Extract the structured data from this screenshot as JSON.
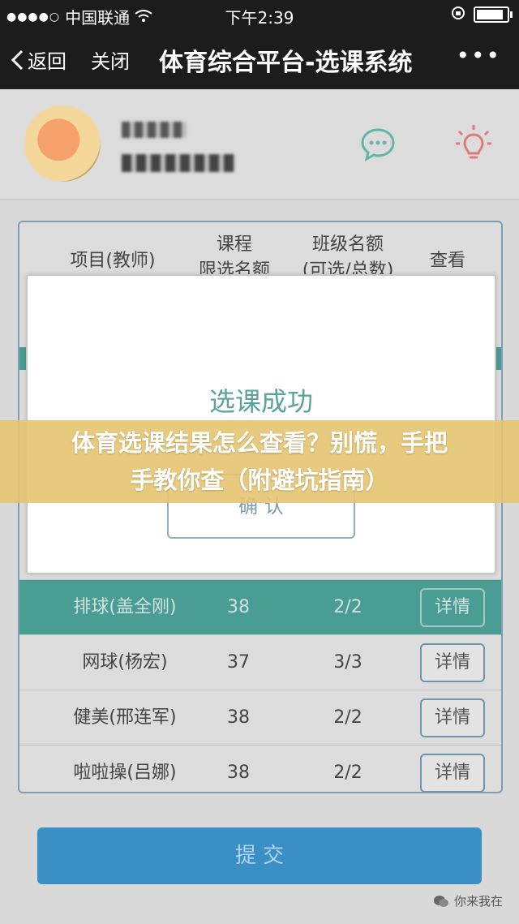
{
  "status_bar": {
    "carrier": "中国联通",
    "time": "下午2:39",
    "battery_level": 0.8
  },
  "navbar": {
    "back_label": "返回",
    "close_label": "关闭",
    "title": "体育综合平台-选课系统",
    "more_label": "•••"
  },
  "table": {
    "headers": [
      {
        "line1": "项目(教师)",
        "line2": ""
      },
      {
        "line1": "课程",
        "line2": "限选名额"
      },
      {
        "line1": "班级名额",
        "line2": "(可选/总数)"
      },
      {
        "line1": "查看",
        "line2": ""
      }
    ],
    "rows": [
      {
        "project": "排球(盖全刚)",
        "limit": "38",
        "quota": "2/2",
        "action": "详情"
      },
      {
        "project": "网球(杨宏)",
        "limit": "37",
        "quota": "3/3",
        "action": "详情"
      },
      {
        "project": "健美(邢连军)",
        "limit": "38",
        "quota": "2/2",
        "action": "详情"
      },
      {
        "project": "啦啦操(吕娜)",
        "limit": "38",
        "quota": "2/2",
        "action": "详情"
      }
    ]
  },
  "submit_label": "提 交",
  "modal": {
    "title": "选课成功",
    "confirm_label": "确 认"
  },
  "banner": {
    "line1": "体育选课结果怎么查看？别慌，手把",
    "line2": "手教你查（附避坑指南）"
  },
  "watermark": "你来我在",
  "colors": {
    "teal": "#4a9d93",
    "blue": "#3a8fc5",
    "banner": "#e4c470"
  }
}
